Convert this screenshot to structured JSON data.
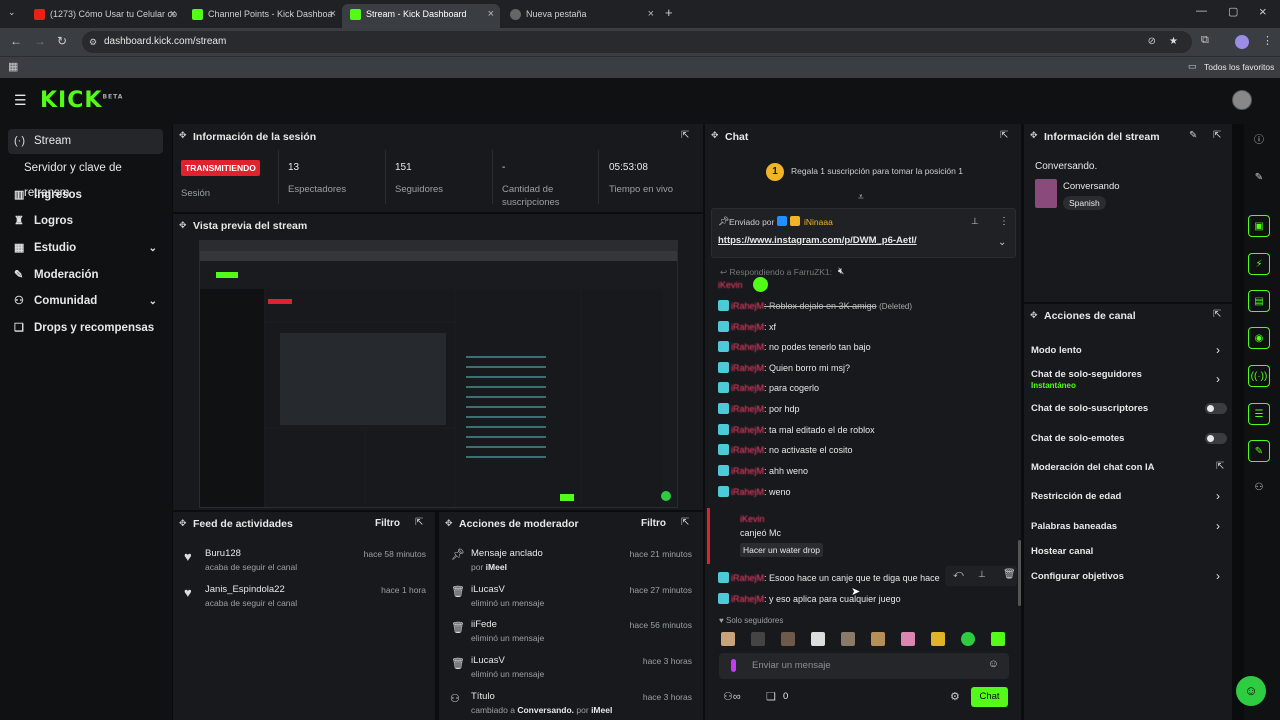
{
  "browser": {
    "tabs": [
      {
        "label": "(1273) Cómo Usar tu Celular co",
        "fav": "#e62117"
      },
      {
        "label": "Channel Points - Kick Dashboa",
        "fav": "#53fc18"
      },
      {
        "label": "Stream - Kick Dashboard",
        "fav": "#53fc18"
      },
      {
        "label": "Nueva pestaña",
        "fav": "#888888"
      }
    ],
    "url": "dashboard.kick.com/stream",
    "bookmarks_label": "Todos los favoritos"
  },
  "brand": {
    "logo": "KICK",
    "beta": "BETA"
  },
  "sidebar": {
    "items": [
      {
        "label": "Stream",
        "icon": "arrows-icon"
      },
      {
        "label": "Servidor y clave de retransm",
        "icon": ""
      },
      {
        "label": "Ingresos",
        "icon": "chart-icon"
      },
      {
        "label": "Logros",
        "icon": "trophy-icon"
      },
      {
        "label": "Estudio",
        "icon": "grid-icon"
      },
      {
        "label": "Moderación",
        "icon": "wrench-icon"
      },
      {
        "label": "Comunidad",
        "icon": "people-icon"
      },
      {
        "label": "Drops y recompensas",
        "icon": "gift-icon"
      }
    ]
  },
  "session": {
    "title": "Información de la sesión",
    "status": "TRANSMITIENDO",
    "status_label": "Sesión",
    "viewers": "13",
    "viewers_label": "Espectadores",
    "followers": "151",
    "followers_label": "Seguidores",
    "subs": "-",
    "subs_label": "Cantidad de suscripciones",
    "uptime": "05:53:08",
    "uptime_label": "Tiempo en vivo"
  },
  "preview": {
    "title": "Vista previa del stream"
  },
  "feed": {
    "title": "Feed de actividades",
    "filter": "Filtro",
    "items": [
      {
        "name": "Buru128",
        "sub": "acaba de seguir el canal",
        "time": "hace 58 minutos"
      },
      {
        "name": "Janis_Espindola22",
        "sub": "acaba de seguir el canal",
        "time": "hace 1 hora"
      }
    ]
  },
  "modactions": {
    "title": "Acciones de moderador",
    "filter": "Filtro",
    "items": [
      {
        "name": "Mensaje anclado",
        "sub_prefix": "por",
        "sub_user": "iMeel",
        "time": "hace 21 minutos"
      },
      {
        "name": "iLucasV",
        "sub": "eliminó un mensaje",
        "time": "hace 27 minutos"
      },
      {
        "name": "iiFede",
        "sub": "eliminó un mensaje",
        "time": "hace 56 minutos"
      },
      {
        "name": "iLucasV",
        "sub": "eliminó un mensaje",
        "time": "hace 3 horas"
      },
      {
        "name": "Título",
        "sub_prefix": "cambiado a",
        "sub_bold": "Conversando.",
        "sub_tail": "por",
        "sub_user": "iMeel",
        "time": "hace 3 horas"
      }
    ]
  },
  "chat": {
    "title": "Chat",
    "gift_text": "Regala 1 suscripción para tomar la posición 1",
    "gift_rank": "1",
    "pinned_by": "Enviado por",
    "pinned_user": "iNinaaa",
    "pinned_link": "https://www.instagram.com/p/DWM_p6-Aetl/",
    "replying": "Respondiendo a FarruZK1:",
    "reply_user": "iKevin",
    "messages": [
      {
        "text": ": Roblox dejalo en 3K amigo",
        "tag": "(Deleted)"
      },
      {
        "text": ": xf"
      },
      {
        "text": ": no podes tenerlo tan bajo"
      },
      {
        "text": ": Quien borro mi msj?"
      },
      {
        "text": ": para cogerlo"
      },
      {
        "text": ": por hdp"
      },
      {
        "text": ": ta mal editado el de roblox"
      },
      {
        "text": ": no activaste el cosito"
      },
      {
        "text": ": ahh weno"
      },
      {
        "text": ": weno"
      }
    ],
    "redeem_user": "iKevin",
    "redeem_text": "canjeó Mc",
    "redeem_item": "Hacer un water drop",
    "after": [
      {
        "text": ": Esooo hace un canje que te diga que hace"
      },
      {
        "text": ": y eso aplica para cualquier juego"
      }
    ],
    "followers_only": "Solo seguidores",
    "input_placeholder": "Enviar un mensaje",
    "count": "0",
    "send": "Chat"
  },
  "streaminfo": {
    "title": "Información del stream",
    "stream_title": "Conversando.",
    "category": "Conversando",
    "language": "Spanish"
  },
  "channel": {
    "title": "Acciones de canal",
    "items": [
      {
        "label": "Modo lento",
        "kind": "chev"
      },
      {
        "label": "Chat de solo-seguidores",
        "sub": "Instantáneo",
        "kind": "chev"
      },
      {
        "label": "Chat de solo-suscriptores",
        "kind": "toggle"
      },
      {
        "label": "Chat de solo-emotes",
        "kind": "toggle"
      },
      {
        "label": "Moderación del chat con IA",
        "kind": "ext"
      },
      {
        "label": "Restricción de edad",
        "kind": "chev"
      },
      {
        "label": "Palabras baneadas",
        "kind": "chev"
      },
      {
        "label": "Hostear canal",
        "kind": "none"
      },
      {
        "label": "Configurar objetivos",
        "kind": "chev"
      }
    ]
  }
}
